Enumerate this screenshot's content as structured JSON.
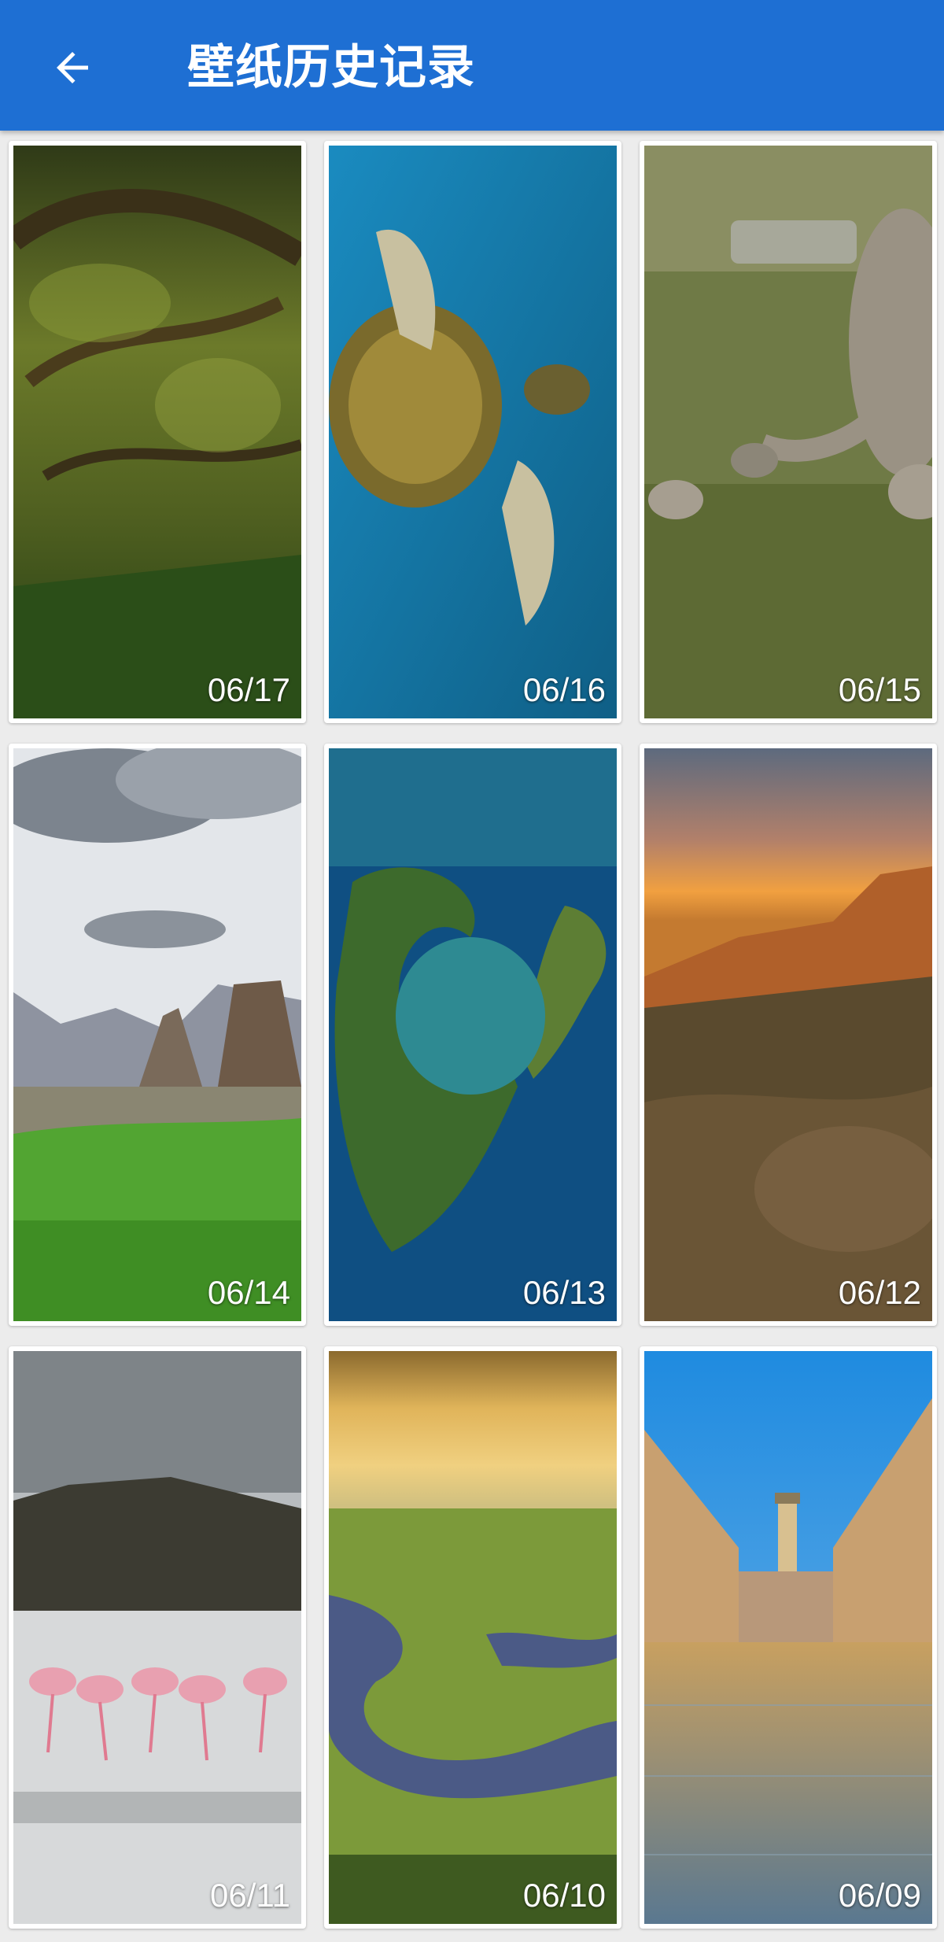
{
  "header": {
    "title": "壁纸历史记录",
    "back_icon": "arrow-back-icon",
    "background": "#1e6fd3"
  },
  "wallpapers": [
    {
      "date": "06/17",
      "subject": "forest"
    },
    {
      "date": "06/16",
      "subject": "sea-turtle"
    },
    {
      "date": "06/15",
      "subject": "rheas"
    },
    {
      "date": "06/14",
      "subject": "mountain-meadow"
    },
    {
      "date": "06/13",
      "subject": "volcanic-islet"
    },
    {
      "date": "06/12",
      "subject": "canyon-sunset"
    },
    {
      "date": "06/11",
      "subject": "flamingos"
    },
    {
      "date": "06/10",
      "subject": "wetland-river"
    },
    {
      "date": "06/09",
      "subject": "old-town-street"
    }
  ]
}
